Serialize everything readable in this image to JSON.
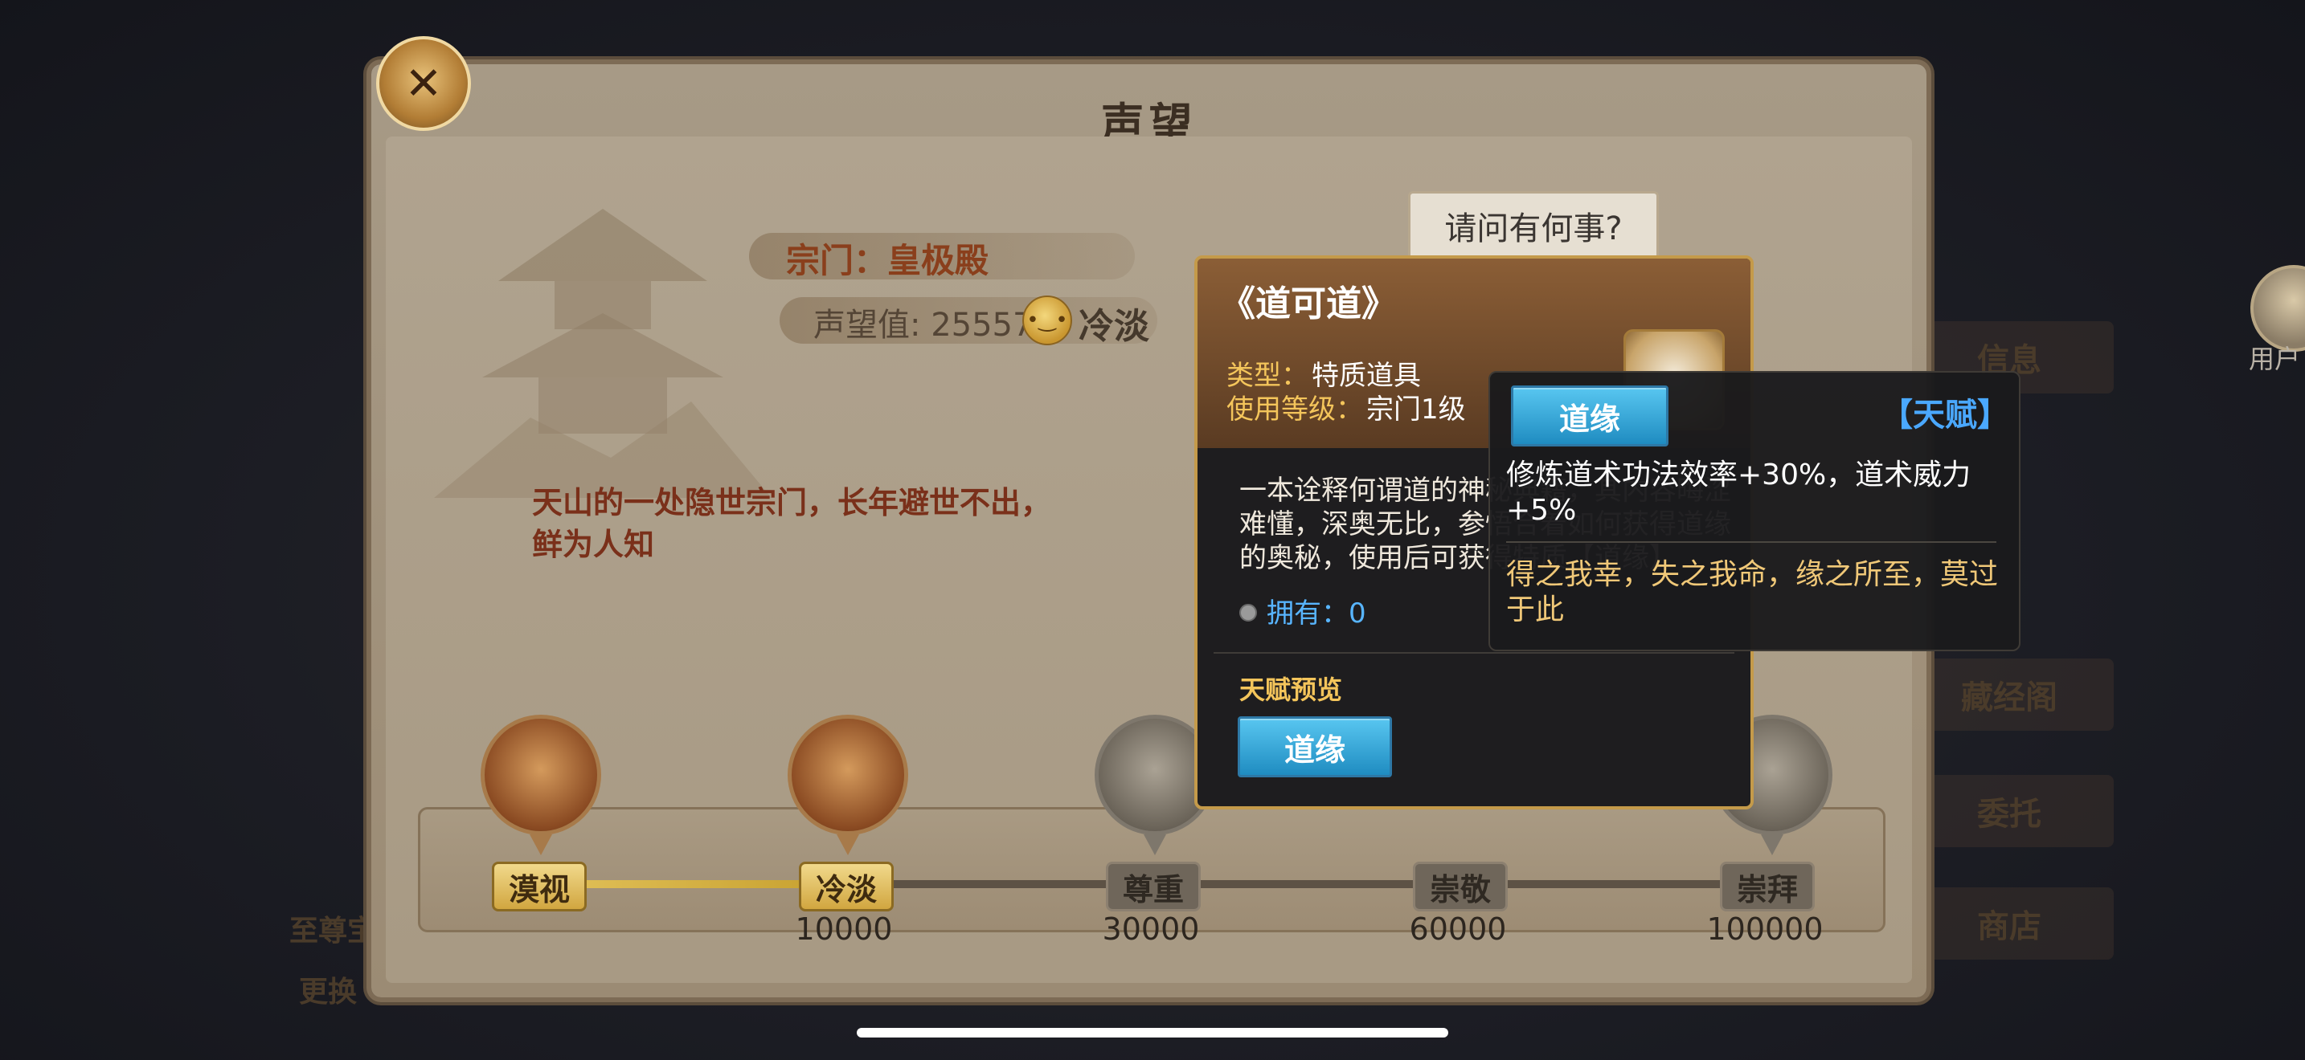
{
  "window": {
    "title": "声望"
  },
  "background": {
    "right_menu": [
      "信息",
      "藏经阁",
      "委托",
      "商店"
    ],
    "left_labels": [
      "至尊宝",
      "更换"
    ],
    "user_label": "用户"
  },
  "sect": {
    "name_line": "宗门：皇极殿",
    "reputation_label": "声望值: 25557",
    "current_level": "冷淡",
    "description": "天山的一处隐世宗门，长年避世不出，鲜为人知"
  },
  "npc_speech": "请问有何事?",
  "progress": {
    "value": 25557,
    "fill_fraction": 0.26,
    "milestones": [
      {
        "label": "漠视",
        "threshold": "",
        "active": true
      },
      {
        "label": "冷淡",
        "threshold": "10000",
        "active": true
      },
      {
        "label": "尊重",
        "threshold": "30000",
        "active": false
      },
      {
        "label": "崇敬",
        "threshold": "60000",
        "active": false
      },
      {
        "label": "崇拜",
        "threshold": "100000",
        "active": false
      }
    ]
  },
  "item_card": {
    "title": "《道可道》",
    "type_key": "类型：",
    "type_value": "特质道具",
    "level_key": "使用等级：",
    "level_value": "宗门1级",
    "description": "一本诠释何谓道的神秘典籍，其内容晦涩难懂，深奥无比，参悟合着如何获得道缘的奥秘，使用后可获得特质【道缘】",
    "own_label": "拥有：0",
    "preview_label": "天赋预览",
    "preview_button": "道缘"
  },
  "tooltip": {
    "button": "道缘",
    "tag": "【天赋】",
    "effect": "修炼道术功法效率+30%，道术威力+5%",
    "flavor": "得之我幸，失之我命，缘之所至，莫过于此"
  },
  "colors": {
    "accent_gold": "#f4c55b",
    "button_blue": "#2a9ed6",
    "tag_blue": "#4aa8ff",
    "sect_red": "#8a3f1c"
  }
}
